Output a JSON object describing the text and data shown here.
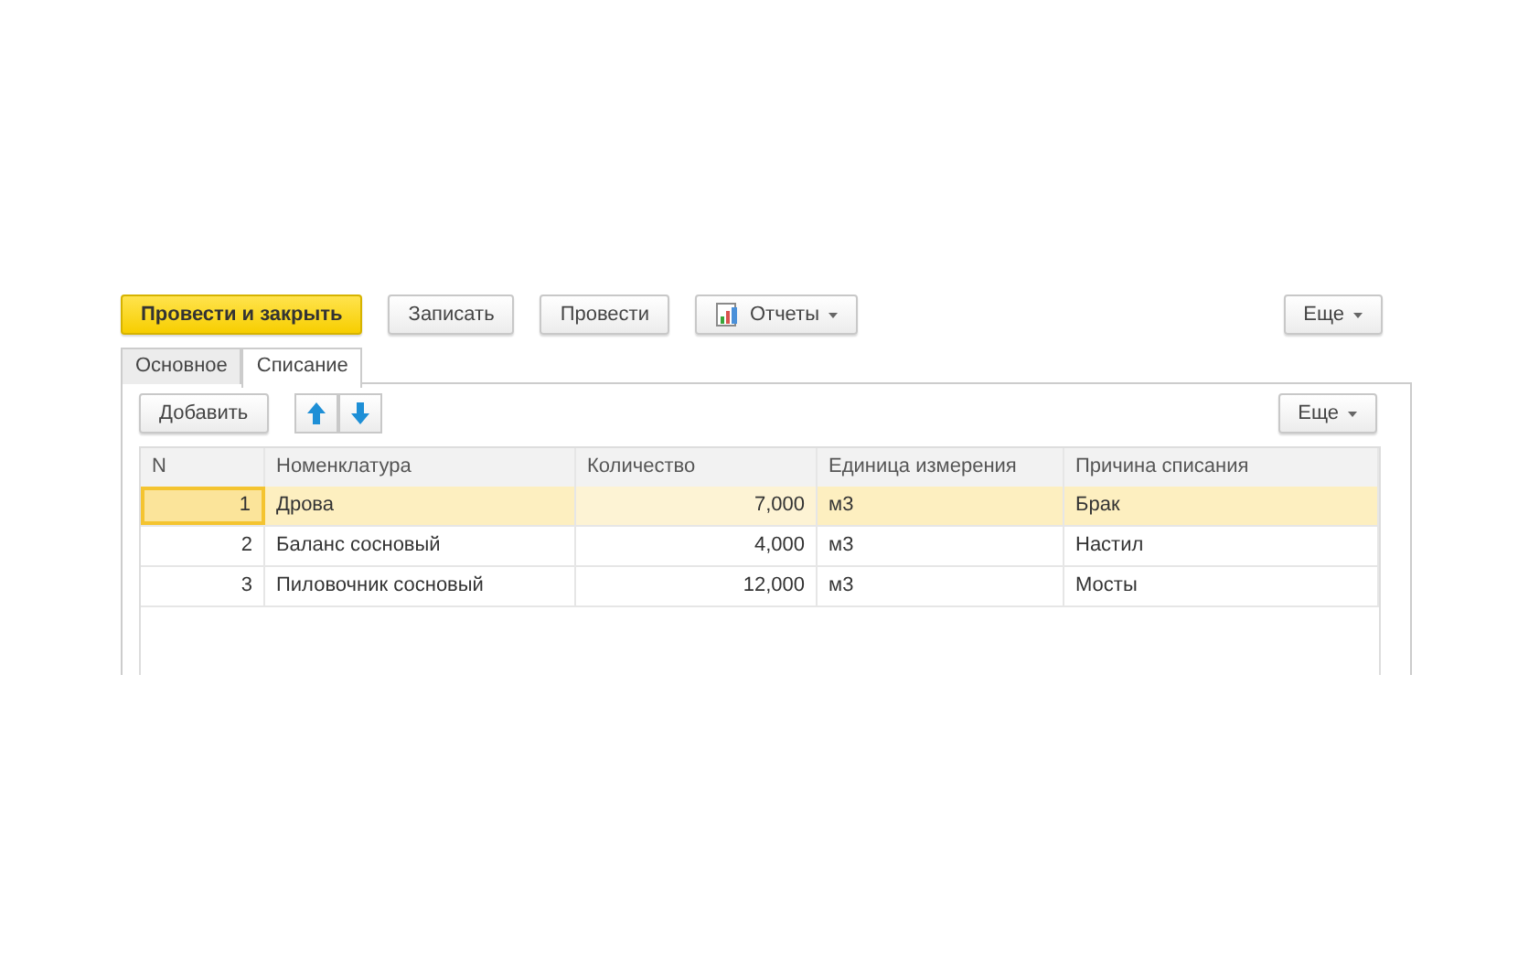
{
  "toolbar": {
    "buttons": [
      {
        "label": "Провести и закрыть",
        "kind": "primary"
      },
      {
        "label": "Записать",
        "kind": "plain"
      },
      {
        "label": "Провести",
        "kind": "plain"
      },
      {
        "label": "Отчеты",
        "kind": "report"
      }
    ],
    "more": "Еще"
  },
  "tabs": [
    {
      "label": "Основное",
      "selected": false
    },
    {
      "label": "Списание",
      "selected": true
    }
  ],
  "table_toolbar": {
    "add": "Добавить",
    "more": "Еще"
  },
  "table": {
    "columns": [
      "N",
      "Номенклатура",
      "Количество",
      "Единица измерения",
      "Причина списания"
    ],
    "rows": [
      {
        "cells": [
          "1",
          "Дрова",
          "7,000",
          "м3",
          "Брак"
        ],
        "selected": true
      },
      {
        "cells": [
          "2",
          "Баланс сосновый",
          "4,000",
          "м3",
          "Настил"
        ],
        "selected": false
      },
      {
        "cells": [
          "3",
          "Пиловочник сосновый",
          "12,000",
          "м3",
          "Мосты"
        ],
        "selected": false
      }
    ]
  }
}
